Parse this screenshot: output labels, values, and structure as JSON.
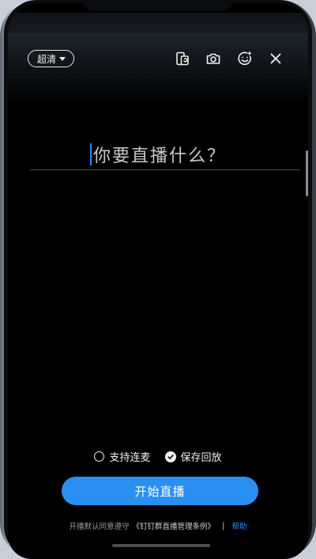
{
  "header": {
    "quality_label": "超清",
    "icons": [
      "flip-camera-icon",
      "camera-icon",
      "beauty-face-icon",
      "close-icon"
    ]
  },
  "main": {
    "title_placeholder": "你要直播什么？"
  },
  "options": {
    "co_host_label": "支持连麦",
    "co_host_checked": false,
    "save_replay_label": "保存回放",
    "save_replay_checked": true
  },
  "actions": {
    "start_label": "开始直播"
  },
  "footer": {
    "agreement_text": "开播默认同意遵守",
    "terms_link": "《钉钉群直播管理条例》",
    "separator": "|",
    "help_link": "帮助"
  },
  "colors": {
    "accent": "#2b8ff2",
    "background": "#000000",
    "text": "#f0f0f0"
  }
}
